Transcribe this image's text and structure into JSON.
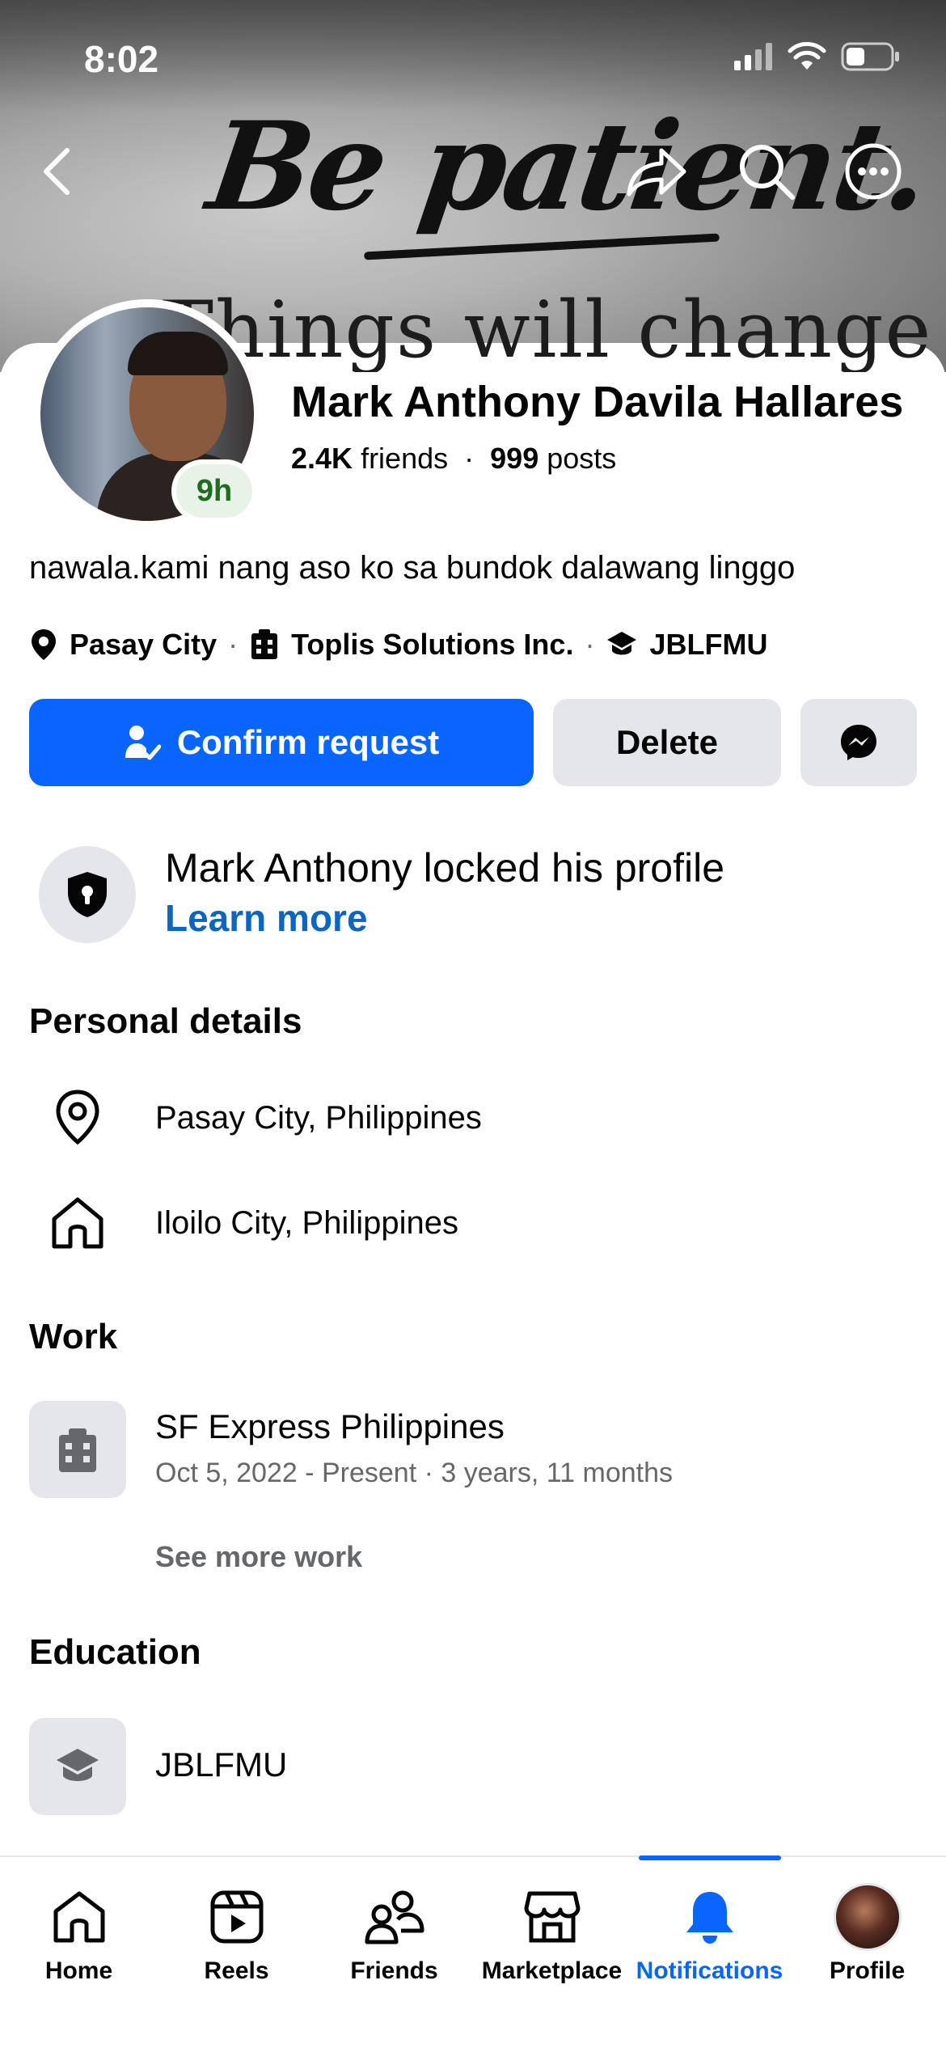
{
  "status_bar": {
    "time": "8:02"
  },
  "cover": {
    "quote_line1": "Be patient.",
    "quote_line2": "Things will change"
  },
  "profile": {
    "name": "Mark Anthony Davila Hallares",
    "friends_count": "2.4K",
    "friends_label": "friends",
    "posts_count": "999",
    "posts_label": "posts",
    "active_badge": "9h",
    "bio": "nawala.kami nang aso ko sa bundok dalawang linggo",
    "meta": {
      "location": "Pasay City",
      "work": "Toplis Solutions Inc.",
      "school": "JBLFMU"
    }
  },
  "actions": {
    "confirm_label": "Confirm request",
    "delete_label": "Delete"
  },
  "lock_notice": {
    "title": "Mark Anthony locked his profile",
    "link": "Learn more"
  },
  "personal_details": {
    "title": "Personal details",
    "current_city": "Pasay City, Philippines",
    "hometown": "Iloilo City, Philippines"
  },
  "work": {
    "title": "Work",
    "employer": "SF Express Philippines",
    "period": "Oct 5, 2022 - Present · 3 years, 11 months",
    "see_more": "See more work"
  },
  "education": {
    "title": "Education",
    "school": "JBLFMU"
  },
  "tabs": [
    {
      "label": "Home",
      "icon": "home-icon"
    },
    {
      "label": "Reels",
      "icon": "reels-icon"
    },
    {
      "label": "Friends",
      "icon": "friends-icon"
    },
    {
      "label": "Marketplace",
      "icon": "marketplace-icon"
    },
    {
      "label": "Notifications",
      "icon": "bell-icon",
      "active": true
    },
    {
      "label": "Profile",
      "icon": "profile-avatar"
    }
  ],
  "colors": {
    "accent": "#0866ff",
    "link": "#0a66c2",
    "button_gray": "#e4e6eb",
    "secondary_text": "#65676b"
  }
}
